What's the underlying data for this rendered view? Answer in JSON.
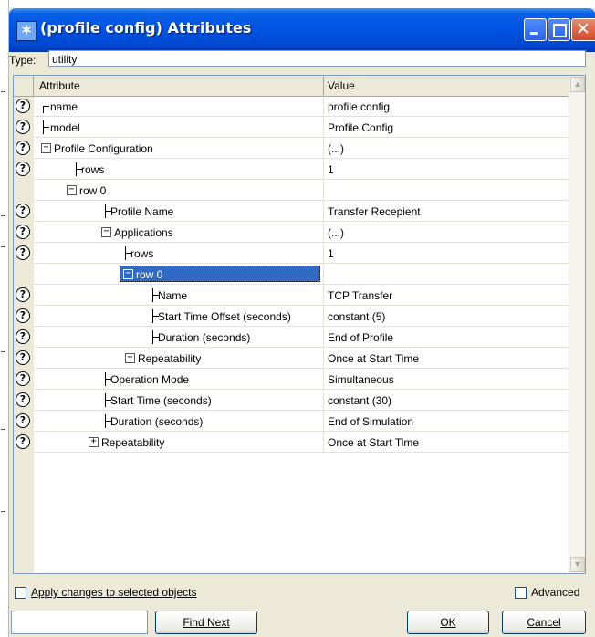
{
  "window": {
    "title": "(profile config) Attributes",
    "title_icon": "star-icon"
  },
  "type": {
    "label": "Type:",
    "value": "utility"
  },
  "grid": {
    "headers": {
      "attribute": "Attribute",
      "value": "Value"
    },
    "rows": [
      {
        "help": true,
        "attribute": "name",
        "value": "profile config"
      },
      {
        "help": true,
        "attribute": "model",
        "value": "Profile Config"
      },
      {
        "help": true,
        "attribute": "Profile Configuration",
        "value": "(...)"
      },
      {
        "help": true,
        "attribute": "rows",
        "value": "1"
      },
      {
        "help": false,
        "attribute": "row 0",
        "value": ""
      },
      {
        "help": true,
        "attribute": "Profile Name",
        "value": "Transfer Recepient"
      },
      {
        "help": true,
        "attribute": "Applications",
        "value": "(...)"
      },
      {
        "help": true,
        "attribute": "rows",
        "value": "1"
      },
      {
        "help": false,
        "attribute": "row 0",
        "value": "",
        "selected": true
      },
      {
        "help": true,
        "attribute": "Name",
        "value": "TCP Transfer"
      },
      {
        "help": true,
        "attribute": "Start Time Offset (seconds)",
        "value": "constant (5)"
      },
      {
        "help": true,
        "attribute": "Duration (seconds)",
        "value": "End of Profile"
      },
      {
        "help": true,
        "attribute": "Repeatability",
        "value": "Once at Start Time"
      },
      {
        "help": true,
        "attribute": "Operation Mode",
        "value": "Simultaneous"
      },
      {
        "help": true,
        "attribute": "Start Time (seconds)",
        "value": "constant (30)"
      },
      {
        "help": true,
        "attribute": "Duration (seconds)",
        "value": "End of Simulation"
      },
      {
        "help": true,
        "attribute": "Repeatability",
        "value": "Once at Start Time"
      }
    ]
  },
  "footer": {
    "apply_label": "Apply changes to selected objects",
    "advanced_label": "Advanced",
    "find_value": "",
    "find_next_label": "Find Next",
    "ok_label": "OK",
    "cancel_label": "Cancel"
  },
  "colors": {
    "titlebar": "#0054e3",
    "selection": "#316ac5",
    "dialog_bg": "#ece9d8"
  }
}
